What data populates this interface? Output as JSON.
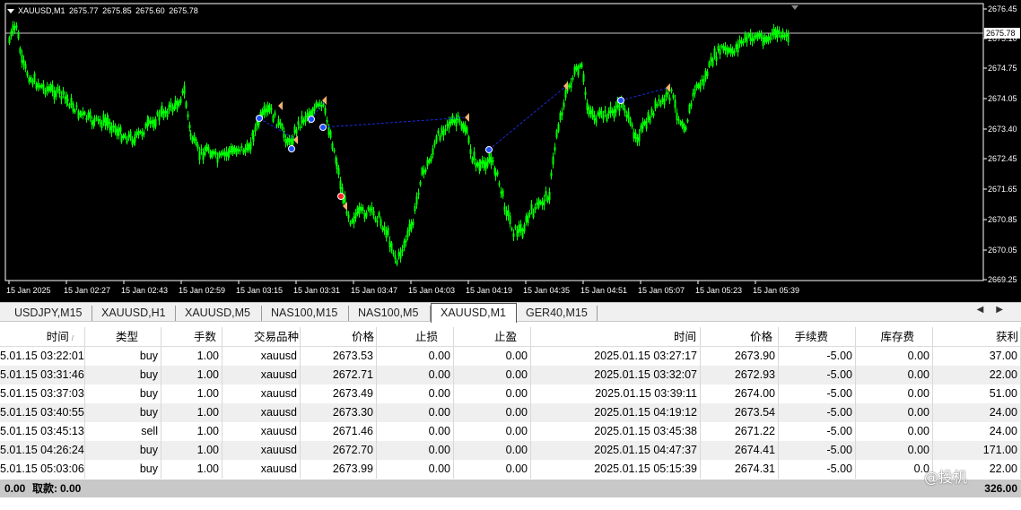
{
  "chart": {
    "symbol_header": "XAUUSD,M1",
    "ohlc": [
      "2675.77",
      "2675.85",
      "2675.60",
      "2675.78"
    ],
    "current_price_label": "2675.78",
    "background_color": "#000000",
    "candle_color": "#00ff00",
    "line_color": "#c8c8c8",
    "trade_line_color": "#1c2bd8",
    "price_labels": [
      "2676.45",
      "2675.10",
      "2674.75",
      "2674.05",
      "2673.40",
      "2672.45",
      "2671.65",
      "2670.85",
      "2670.05",
      "2669.25"
    ],
    "time_labels": [
      "15 Jan 2025",
      "15 Jan 02:27",
      "15 Jan 02:43",
      "15 Jan 02:59",
      "15 Jan 03:15",
      "15 Jan 03:31",
      "15 Jan 03:47",
      "15 Jan 04:03",
      "15 Jan 04:19",
      "15 Jan 04:35",
      "15 Jan 04:51",
      "15 Jan 05:07",
      "15 Jan 05:23",
      "15 Jan 05:39"
    ]
  },
  "tabs": [
    {
      "label": "USDJPY,M15",
      "active": false
    },
    {
      "label": "XAUUSD,H1",
      "active": false
    },
    {
      "label": "XAUUSD,M5",
      "active": false
    },
    {
      "label": "NAS100,M15",
      "active": false
    },
    {
      "label": "NAS100,M5",
      "active": false
    },
    {
      "label": "XAUUSD,M1",
      "active": true
    },
    {
      "label": "GER40,M15",
      "active": false
    }
  ],
  "tab_arrows": [
    "◀",
    "▶"
  ],
  "table": {
    "headers": [
      "时间",
      "类型",
      "手数",
      "交易品种",
      "价格",
      "止损",
      "止盈",
      "时间",
      "价格",
      "手续费",
      "库存费",
      "获利"
    ],
    "sort_indicator": "/",
    "rows": [
      [
        "5.01.15 03:22:01",
        "buy",
        "1.00",
        "xauusd",
        "2673.53",
        "0.00",
        "0.00",
        "2025.01.15 03:27:17",
        "2673.90",
        "-5.00",
        "0.00",
        "37.00"
      ],
      [
        "5.01.15 03:31:46",
        "buy",
        "1.00",
        "xauusd",
        "2672.71",
        "0.00",
        "0.00",
        "2025.01.15 03:32:07",
        "2672.93",
        "-5.00",
        "0.00",
        "22.00"
      ],
      [
        "5.01.15 03:37:03",
        "buy",
        "1.00",
        "xauusd",
        "2673.49",
        "0.00",
        "0.00",
        "2025.01.15 03:39:11",
        "2674.00",
        "-5.00",
        "0.00",
        "51.00"
      ],
      [
        "5.01.15 03:40:55",
        "buy",
        "1.00",
        "xauusd",
        "2673.30",
        "0.00",
        "0.00",
        "2025.01.15 04:19:12",
        "2673.54",
        "-5.00",
        "0.00",
        "24.00"
      ],
      [
        "5.01.15 03:45:13",
        "sell",
        "1.00",
        "xauusd",
        "2671.46",
        "0.00",
        "0.00",
        "2025.01.15 03:45:38",
        "2671.22",
        "-5.00",
        "0.00",
        "24.00"
      ],
      [
        "5.01.15 04:26:24",
        "buy",
        "1.00",
        "xauusd",
        "2672.70",
        "0.00",
        "0.00",
        "2025.01.15 04:47:37",
        "2674.41",
        "-5.00",
        "0.00",
        "171.00"
      ],
      [
        "5.01.15 05:03:06",
        "buy",
        "1.00",
        "xauusd",
        "2673.99",
        "0.00",
        "0.00",
        "2025.01.15 05:15:39",
        "2674.31",
        "-5.00",
        "0.0",
        "22.00"
      ]
    ]
  },
  "footer": {
    "balance": "0.00",
    "withdraw_label": "取款:",
    "withdraw_value": "0.00",
    "total_profit": "326.00"
  },
  "watermark": "@投机"
}
